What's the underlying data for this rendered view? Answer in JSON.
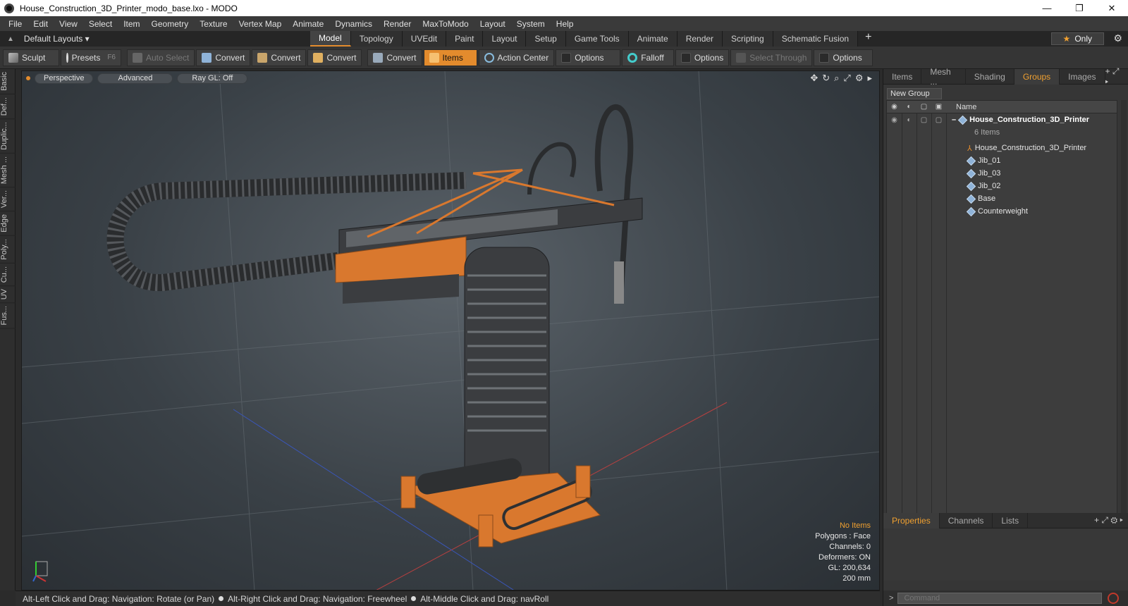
{
  "window": {
    "title": "House_Construction_3D_Printer_modo_base.lxo - MODO",
    "controls": [
      "—",
      "❐",
      "✕"
    ]
  },
  "menu": [
    "File",
    "Edit",
    "View",
    "Select",
    "Item",
    "Geometry",
    "Texture",
    "Vertex Map",
    "Animate",
    "Dynamics",
    "Render",
    "MaxToModo",
    "Layout",
    "System",
    "Help"
  ],
  "layoutbar": {
    "layout_dropdown": "Default Layouts ▾",
    "tabs": [
      "Model",
      "Topology",
      "UVEdit",
      "Paint",
      "Layout",
      "Setup",
      "Game Tools",
      "Animate",
      "Render",
      "Scripting",
      "Schematic Fusion"
    ],
    "active_tab": "Model",
    "plus": "+",
    "only_label": "Only",
    "gear": "⚙"
  },
  "toolbar": {
    "sculpt": "Sculpt",
    "presets": "Presets",
    "presets_key": "F6",
    "auto_select": "Auto Select",
    "convert": "Convert",
    "items": "Items",
    "action_center": "Action Center",
    "options": "Options",
    "falloff": "Falloff",
    "select_through": "Select Through"
  },
  "left_tabs": [
    "Basic",
    "Def...",
    "Duplic...",
    "Mesh ...",
    "Ver...",
    "Edge",
    "Poly...",
    "Cu...",
    "UV",
    "Fus..."
  ],
  "viewport": {
    "view_mode": "Perspective",
    "shading": "Advanced",
    "raygl": "Ray GL: Off",
    "stats": {
      "selection": "No Items",
      "polygons": "Polygons : Face",
      "channels": "Channels: 0",
      "deformers": "Deformers: ON",
      "gl": "GL: 200,634",
      "grid": "200 mm"
    }
  },
  "statusbar": {
    "hint1": "Alt-Left Click and Drag: Navigation: Rotate (or Pan)",
    "hint2": "Alt-Right Click and Drag: Navigation: Freewheel",
    "hint3": "Alt-Middle Click and Drag: navRoll"
  },
  "right_panel": {
    "tabs": [
      "Items",
      "Mesh ...",
      "Shading",
      "Groups",
      "Images"
    ],
    "active_tab": "Groups",
    "new_group": "New Group",
    "column_name": "Name",
    "tree": {
      "root": "House_Construction_3D_Printer",
      "root_count": "6 Items",
      "children": [
        "House_Construction_3D_Printer",
        "Jib_01",
        "Jib_03",
        "Jib_02",
        "Base",
        "Counterweight"
      ]
    },
    "bottom_tabs": [
      "Properties",
      "Channels",
      "Lists"
    ],
    "bottom_active": "Properties",
    "command_placeholder": "Command"
  },
  "colors": {
    "accent": "#e38b2d",
    "machine_orange": "#d9782e",
    "machine_dark": "#3b3d40"
  }
}
